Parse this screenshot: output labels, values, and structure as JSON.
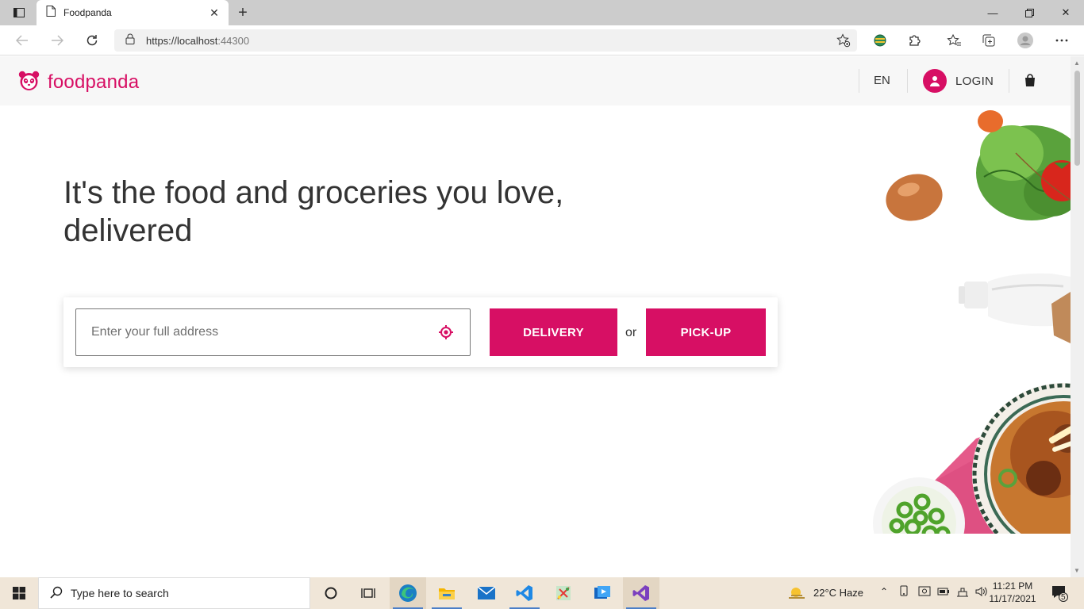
{
  "browser": {
    "tab_title": "Foodpanda",
    "url_host": "https://localhost",
    "url_port": ":44300"
  },
  "header": {
    "brand": "foodpanda",
    "language": "EN",
    "login_label": "LOGIN"
  },
  "hero": {
    "title_line1": "It's the food and groceries you love,",
    "title_line2": "delivered"
  },
  "search": {
    "address_placeholder": "Enter your full address",
    "delivery_label": "DELIVERY",
    "or_label": "or",
    "pickup_label": "PICK-UP"
  },
  "taskbar": {
    "search_placeholder": "Type here to search",
    "weather": "22°C  Haze",
    "time": "11:21 PM",
    "date": "11/17/2021",
    "notification_count": "5"
  },
  "colors": {
    "brand_pink": "#d70f64"
  }
}
